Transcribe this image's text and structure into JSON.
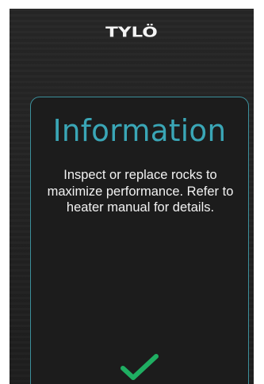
{
  "header": {
    "logo_text": "TYLÖ"
  },
  "dialog": {
    "title": "Information",
    "message": "Inspect or replace rocks to maximize performance. Refer to heater manual for details.",
    "confirm_icon": "checkmark-icon",
    "accent_color": "#3aa6b6",
    "confirm_color": "#1fae62"
  }
}
